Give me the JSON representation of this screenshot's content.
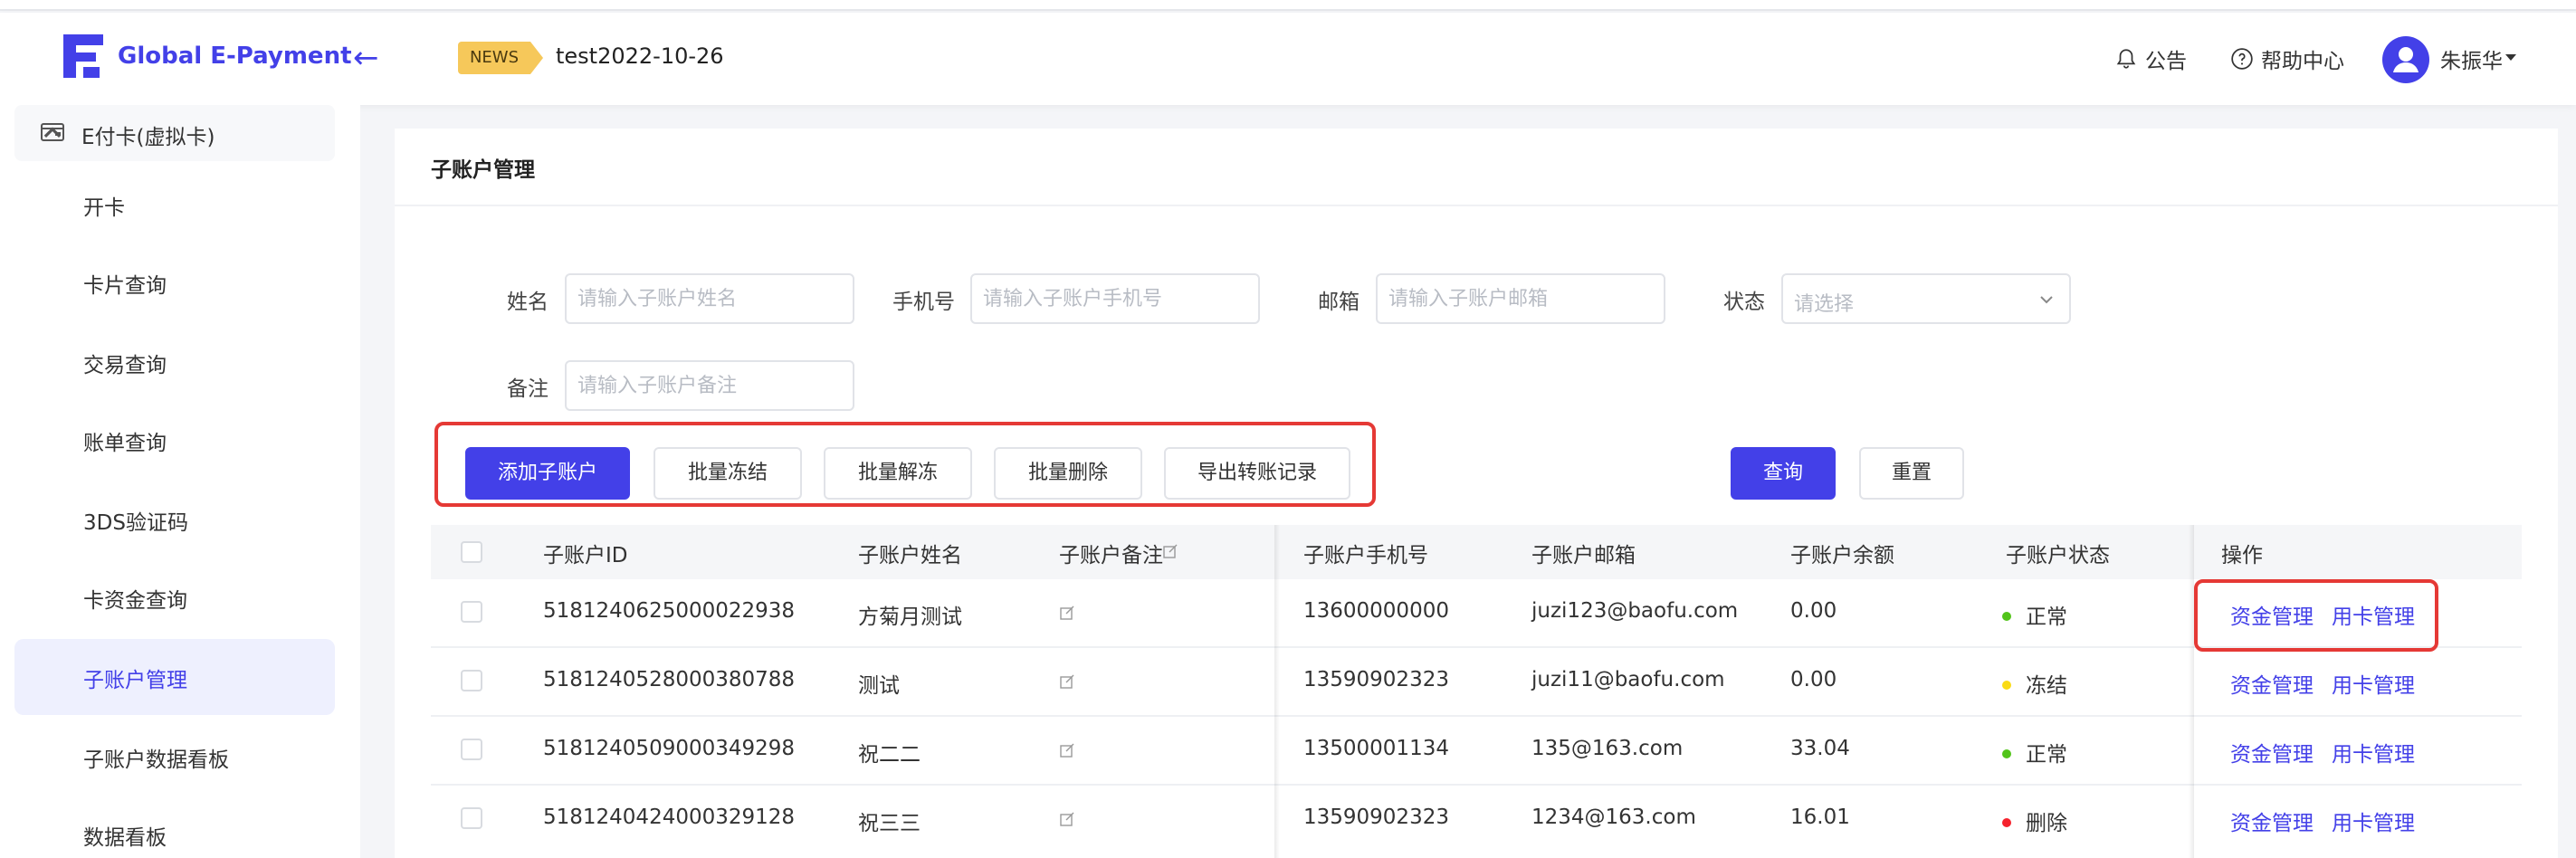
{
  "header": {
    "brand": "Global E-Payment",
    "news_badge": "NEWS",
    "news_text": "test2022-10-26",
    "notice": "公告",
    "help": "帮助中心",
    "user": "朱振华"
  },
  "sidebar": {
    "group": "E付卡(虚拟卡)",
    "items": [
      "开卡",
      "卡片查询",
      "交易查询",
      "账单查询",
      "3DS验证码",
      "卡资金查询",
      "子账户管理",
      "子账户数据看板",
      "数据看板"
    ],
    "active": "子账户管理"
  },
  "page": {
    "title": "子账户管理"
  },
  "filters": {
    "name_label": "姓名",
    "name_placeholder": "请输入子账户姓名",
    "phone_label": "手机号",
    "phone_placeholder": "请输入子账户手机号",
    "email_label": "邮箱",
    "email_placeholder": "请输入子账户邮箱",
    "status_label": "状态",
    "status_placeholder": "请选择",
    "remark_label": "备注",
    "remark_placeholder": "请输入子账户备注"
  },
  "actions": {
    "add": "添加子账户",
    "batch_freeze": "批量冻结",
    "batch_unfreeze": "批量解冻",
    "batch_delete": "批量删除",
    "export": "导出转账记录",
    "query": "查询",
    "reset": "重置"
  },
  "table": {
    "headers": [
      "子账户ID",
      "子账户姓名",
      "子账户备注",
      "子账户手机号",
      "子账户邮箱",
      "子账户余额",
      "子账户状态",
      "操作"
    ],
    "op_fund": "资金管理",
    "op_card": "用卡管理",
    "rows": [
      {
        "id": "5181240625000022938",
        "name": "方菊月测试",
        "phone": "13600000000",
        "email": "juzi123@baofu.com",
        "balance": "0.00",
        "status": "正常",
        "status_color": "#52c41a"
      },
      {
        "id": "5181240528000380788",
        "name": "测试",
        "phone": "13590902323",
        "email": "juzi11@baofu.com",
        "balance": "0.00",
        "status": "冻结",
        "status_color": "#fadb14"
      },
      {
        "id": "5181240509000349298",
        "name": "祝二二",
        "phone": "13500001134",
        "email": "135@163.com",
        "balance": "33.04",
        "status": "正常",
        "status_color": "#52c41a"
      },
      {
        "id": "5181240424000329128",
        "name": "祝三三",
        "phone": "13590902323",
        "email": "1234@163.com",
        "balance": "16.01",
        "status": "删除",
        "status_color": "#f5222d"
      }
    ]
  },
  "colors": {
    "accent": "#4340e8",
    "highlight": "#e53935"
  }
}
